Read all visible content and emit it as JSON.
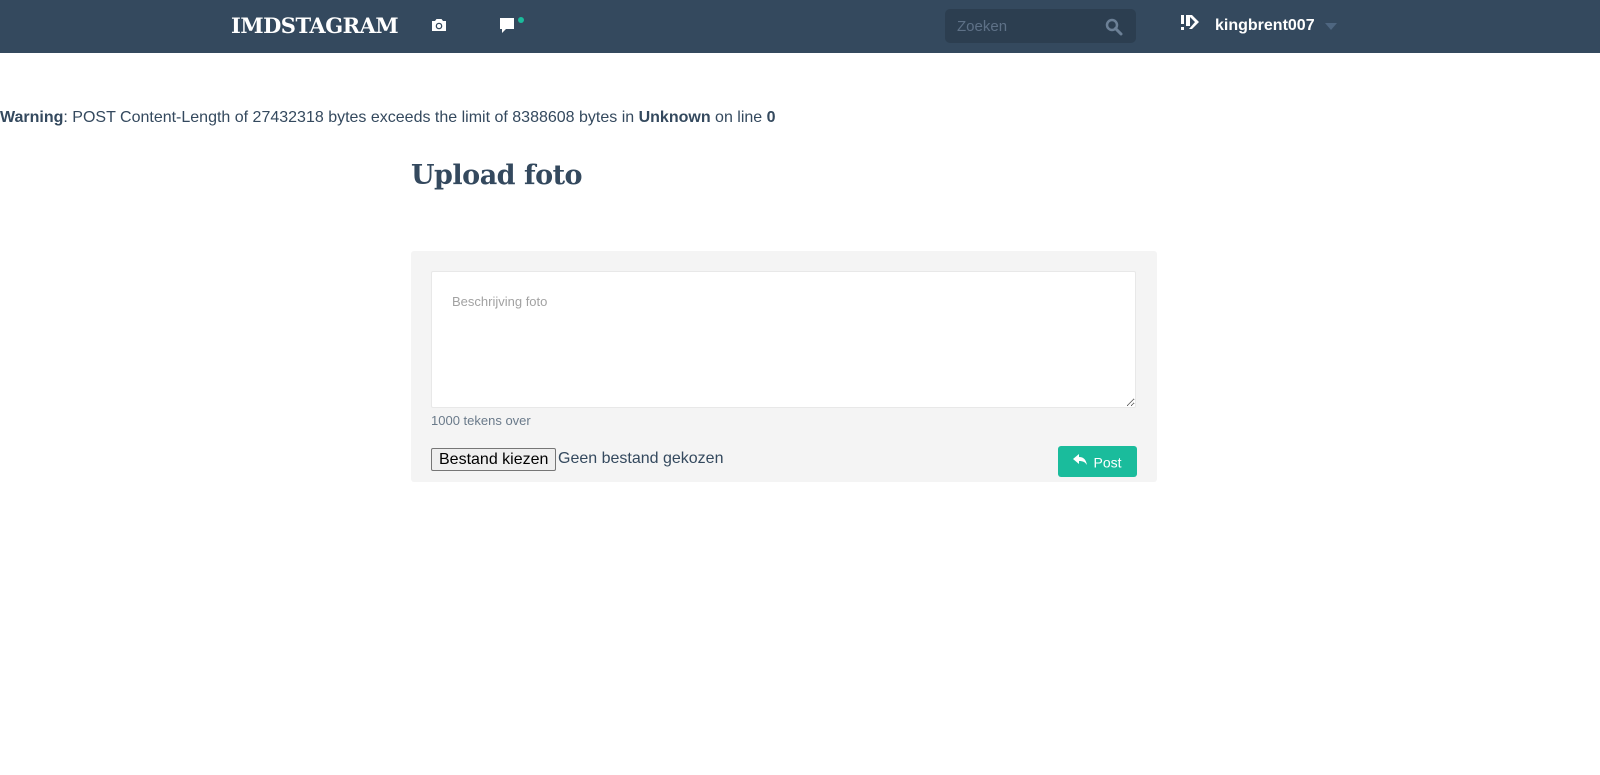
{
  "navbar": {
    "brand": "IMDSTAGRAM",
    "icons": [
      "camera-icon",
      "chat-icon"
    ],
    "notification_dot_color": "#1abc9c",
    "search": {
      "placeholder": "Zoeken",
      "value": ""
    },
    "user": {
      "username": "kingbrent007",
      "avatar_icon": "brand-logo-icon"
    }
  },
  "warning": {
    "prefix": "Warning",
    "message": ": POST Content-Length of 27432318 bytes exceeds the limit of 8388608 bytes in ",
    "location": "Unknown",
    "line_text": " on line ",
    "line_number": "0"
  },
  "upload": {
    "title": "Upload foto",
    "description_placeholder": "Beschrijving foto",
    "description_value": "",
    "char_count": "1000 tekens over",
    "file_button_label": "Bestand kiezen",
    "file_status": "Geen bestand gekozen",
    "post_label": "Post"
  },
  "colors": {
    "navbar": "#34495e",
    "search_bg": "#2c3e50",
    "accent": "#1abc9c",
    "panel_bg": "#f4f4f4",
    "text": "#34495e"
  }
}
